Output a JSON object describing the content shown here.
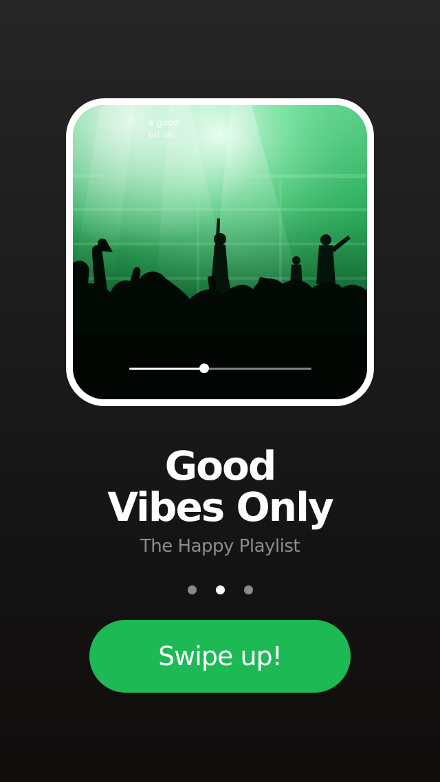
{
  "playlist": {
    "title_line1": "Good",
    "title_line2": "Vibes Only",
    "subtitle": "The Happy Playlist"
  },
  "player": {
    "progress_fraction": 0.41,
    "artwork_overlay_text_line1": "e good",
    "artwork_overlay_text_line2": "od oh"
  },
  "pager": {
    "count": 3,
    "active_index": 1
  },
  "cta": {
    "label": "Swipe up!"
  },
  "colors": {
    "accent": "#1db954",
    "artwork_tint": "#2ecc71",
    "background_top": "#262626",
    "background_bottom": "#0f0d0c"
  }
}
